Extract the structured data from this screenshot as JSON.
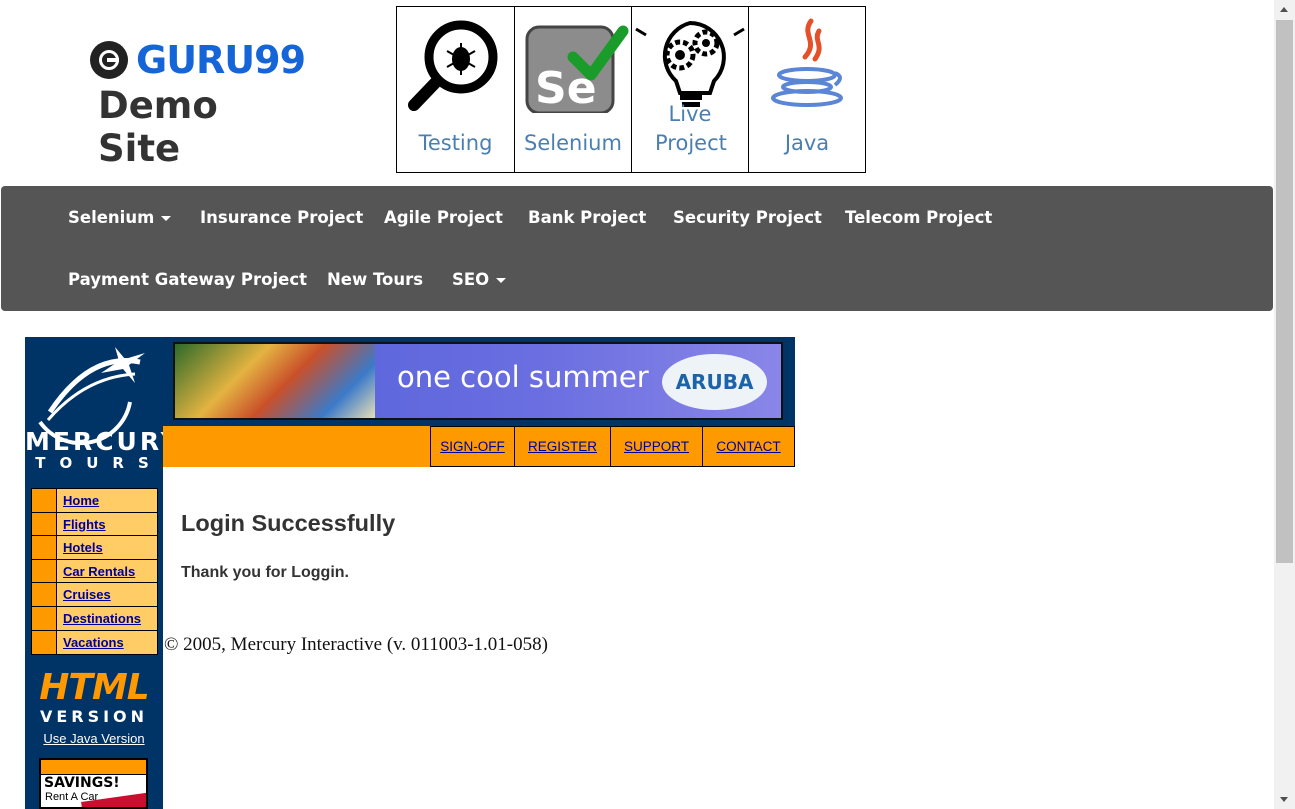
{
  "header": {
    "brand": "GURU99",
    "subtitle": "Demo Site",
    "topics": [
      {
        "label": "Testing",
        "icon": "magnifier-bug-icon"
      },
      {
        "label": "Selenium",
        "icon": "selenium-logo-icon"
      },
      {
        "label": "Live Project",
        "icon": "lightbulb-gears-icon"
      },
      {
        "label": "Java",
        "icon": "java-cup-icon"
      }
    ]
  },
  "navbar": {
    "items": [
      "Selenium",
      "Insurance Project",
      "Agile Project",
      "Bank Project",
      "Security Project",
      "Telecom Project",
      "Payment Gateway Project",
      "New Tours",
      "SEO"
    ]
  },
  "mercury": {
    "logo_top": "MERCURY",
    "logo_bottom": "TOURS",
    "banner_text": "one cool summer",
    "banner_badge": "ARUBA",
    "top_links": [
      "SIGN-OFF",
      "REGISTER",
      "SUPPORT",
      "CONTACT"
    ],
    "side_menu": [
      "Home",
      "Flights",
      "Hotels",
      "Car Rentals",
      "Cruises",
      "Destinations",
      "Vacations"
    ],
    "html_label": "HTML",
    "version_label": "VERSION",
    "java_link": "Use Java Version",
    "ad_title": "SAVINGS!",
    "ad_sub": "Rent A Car"
  },
  "content": {
    "title": "Login Successfully",
    "message": "Thank you for Loggin.",
    "copyright": "© 2005, Mercury Interactive (v. 011003-1.01-058)"
  },
  "colors": {
    "brand_blue": "#1565d8",
    "navbar_bg": "#555555",
    "mercury_navy": "#003366",
    "mercury_orange": "#ff9900",
    "menu_bg": "#ffcc66",
    "link_blue": "#000099"
  }
}
